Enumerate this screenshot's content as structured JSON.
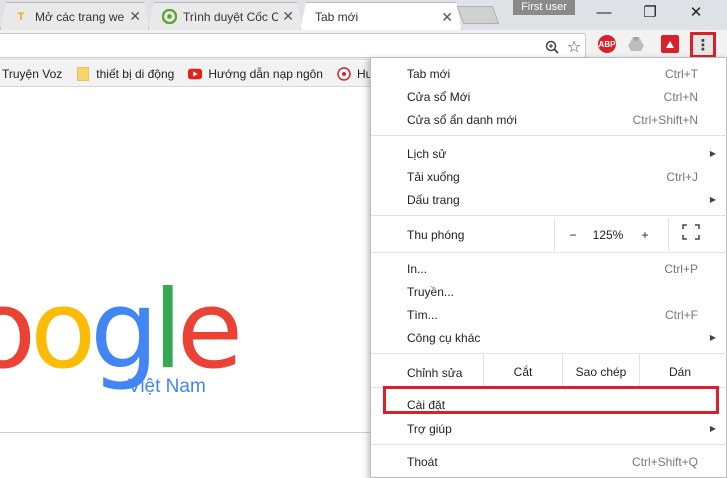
{
  "tabs": [
    {
      "title": "Mở các trang web",
      "favicon": "T",
      "favicon_color": "#f5a623"
    },
    {
      "title": "Trình duyệt Cốc Cốc",
      "favicon": "coccoc-icon",
      "favicon_color": "#5aa632"
    },
    {
      "title": "Tab mới",
      "favicon": "",
      "favicon_color": ""
    }
  ],
  "tab_close": "✕",
  "profile_label": "First user",
  "window_controls": {
    "minimize": "—",
    "restore": "❐",
    "close": "✕"
  },
  "omnibox": {
    "zoom_icon": "🔍",
    "star_icon": "☆"
  },
  "extensions": [
    {
      "name": "abp-icon",
      "label": "ABP",
      "color": "#d9202b"
    },
    {
      "name": "drive-icon",
      "label": "",
      "color": "#9e9e9e"
    },
    {
      "name": "extension-icon",
      "label": "",
      "color": "#d9202b"
    }
  ],
  "menu_button": "⋮",
  "bookmarks": [
    {
      "label": "Truyện Voz",
      "icon": "none"
    },
    {
      "label": "thiết bị di động",
      "icon": "folder"
    },
    {
      "label": "Hướng dẫn nạp ngôn",
      "icon": "youtube"
    },
    {
      "label": "Hu",
      "icon": "globe"
    }
  ],
  "logo": {
    "letters": [
      "o",
      "o",
      "g",
      "l",
      "e"
    ],
    "colors": [
      "#ea4335",
      "#fbbc05",
      "#4285f4",
      "#34a853",
      "#ea4335"
    ],
    "subtitle": "Việt Nam"
  },
  "menu": {
    "new_tab": {
      "label": "Tab mới",
      "shortcut": "Ctrl+T"
    },
    "new_window": {
      "label": "Cửa sổ Mới",
      "shortcut": "Ctrl+N"
    },
    "incognito": {
      "label": "Cửa sổ ẩn danh mới",
      "shortcut": "Ctrl+Shift+N"
    },
    "history": {
      "label": "Lịch sử"
    },
    "downloads": {
      "label": "Tải xuống",
      "shortcut": "Ctrl+J"
    },
    "bookmarks": {
      "label": "Dấu trang"
    },
    "zoom": {
      "label": "Thu phóng",
      "minus": "−",
      "value": "125%",
      "plus": "+",
      "fullscreen": "⛶"
    },
    "print": {
      "label": "In...",
      "shortcut": "Ctrl+P"
    },
    "cast": {
      "label": "Truyền..."
    },
    "find": {
      "label": "Tìm...",
      "shortcut": "Ctrl+F"
    },
    "more_tools": {
      "label": "Công cụ khác"
    },
    "edit": {
      "label": "Chỉnh sửa",
      "cut": "Cắt",
      "copy": "Sao chép",
      "paste": "Dán"
    },
    "settings": {
      "label": "Cài đặt"
    },
    "help": {
      "label": "Trợ giúp"
    },
    "exit": {
      "label": "Thoát",
      "shortcut": "Ctrl+Shift+Q"
    }
  },
  "submenu_arrow": "▶",
  "colors": {
    "highlight": "#d9202b",
    "accent": "#4285f4"
  }
}
